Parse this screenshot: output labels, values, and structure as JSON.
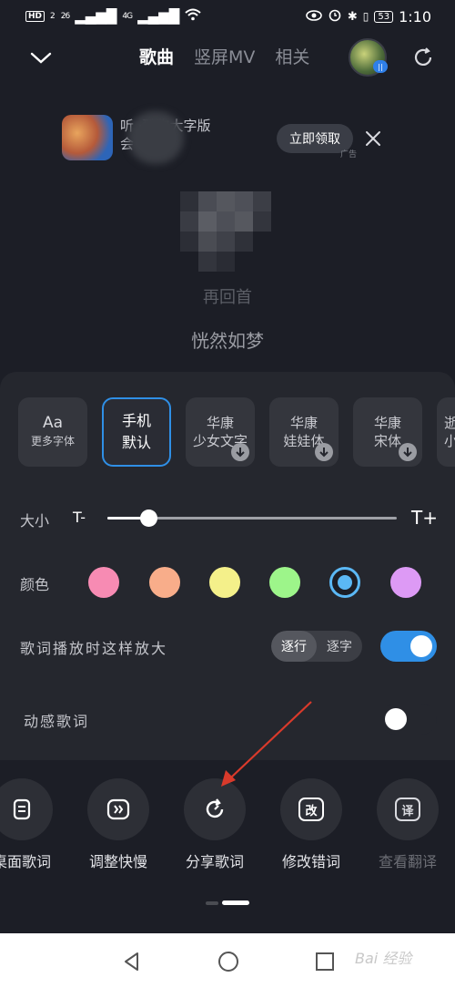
{
  "status_bar": {
    "hd": "HD",
    "sim": "2",
    "net1": "26",
    "net2": "4G",
    "battery": "53",
    "time": "1:10"
  },
  "nav": {
    "tabs": [
      {
        "label": "歌曲",
        "active": true
      },
      {
        "label": "竖屏MV",
        "active": false
      },
      {
        "label": "相关",
        "active": false
      }
    ],
    "avatar_badge": "||"
  },
  "ad": {
    "text_line1": "听   ·酷狗大字版",
    "text_line2": "会         3",
    "claim_button": "立即领取",
    "ad_label": "广告"
  },
  "song": {
    "artist": "再回首",
    "current_lyric": "恍然如梦"
  },
  "fonts": {
    "items": [
      {
        "label_top": "Aa",
        "label_bottom": "更多字体",
        "kind": "more"
      },
      {
        "label_top": "手机",
        "label_bottom": "默认",
        "kind": "selected"
      },
      {
        "label_top": "华康",
        "label_bottom": "少女文字",
        "kind": "download"
      },
      {
        "label_top": "华康",
        "label_bottom": "娃娃体",
        "kind": "download"
      },
      {
        "label_top": "华康",
        "label_bottom": "宋体",
        "kind": "download"
      },
      {
        "label_top": "逝",
        "label_bottom": "小",
        "kind": "partial"
      }
    ]
  },
  "size": {
    "label": "大小",
    "min_label": "T-",
    "max_label": "T+",
    "level": 0.14
  },
  "color": {
    "label": "颜色",
    "swatches": [
      "#f78bb3",
      "#f8ad8a",
      "#f4f08a",
      "#9df58a",
      "#5bb8f5",
      "#dd9af5"
    ],
    "selected_index": 4
  },
  "zoom": {
    "label": "歌词播放时这样放大",
    "options": [
      "逐行",
      "逐字"
    ],
    "selected": "逐行",
    "toggle_on": true
  },
  "dynamic": {
    "label": "动感歌词",
    "toggle_on": false
  },
  "actions": [
    {
      "label": "桌面歌词",
      "icon": "desktop-lyrics-icon",
      "dim": false
    },
    {
      "label": "调整快慢",
      "icon": "fast-forward-icon",
      "dim": false
    },
    {
      "label": "分享歌词",
      "icon": "share-icon",
      "dim": false
    },
    {
      "label": "修改错词",
      "icon": "edit-icon",
      "dim": false
    },
    {
      "label": "查看翻译",
      "icon": "translate-icon",
      "dim": true
    }
  ],
  "action_glyphs": {
    "edit": "改",
    "translate": "译"
  },
  "watermark": "Bai 经验",
  "colors": {
    "accent": "#2f8fe6",
    "background": "#1c1e26",
    "sheet": "#25272e",
    "arrow": "#d93a2b"
  }
}
